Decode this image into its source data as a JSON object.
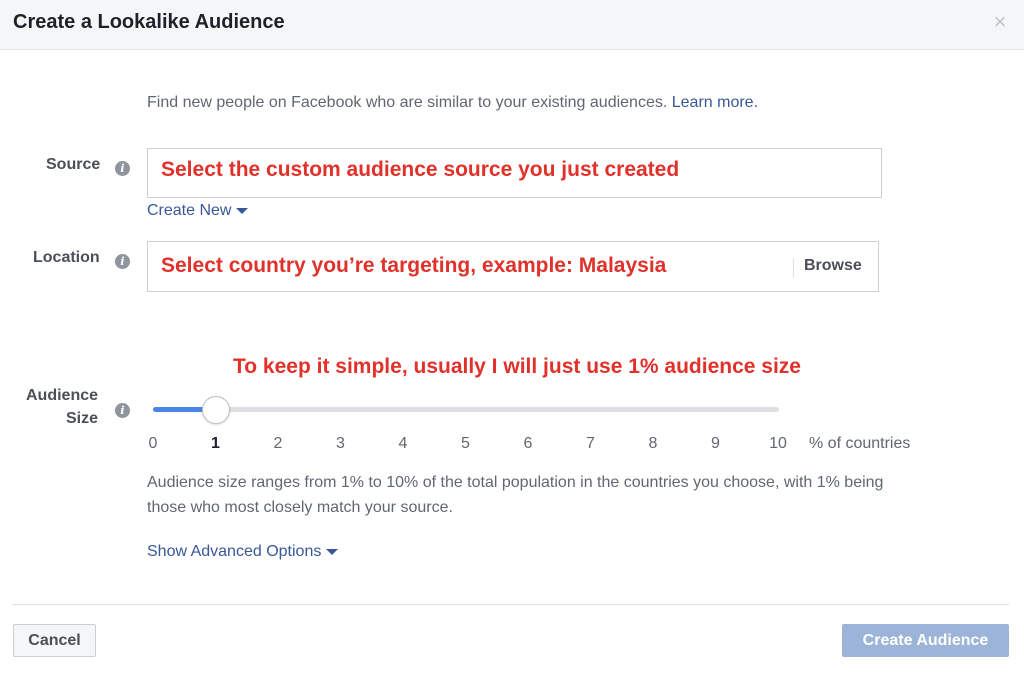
{
  "dialog": {
    "title": "Create a Lookalike Audience",
    "close_icon": "close-icon"
  },
  "intro": {
    "text": "Find new people on Facebook who are similar to your existing audiences.",
    "link": "Learn more."
  },
  "source": {
    "label": "Source",
    "value": "Select the custom audience source you just created",
    "create_new": "Create New"
  },
  "location": {
    "label": "Location",
    "value": "Select country you’re targeting, example: Malaysia",
    "browse": "Browse"
  },
  "audience_size": {
    "label_line1": "Audience",
    "label_line2": "Size",
    "annotation": "To keep it simple, usually I will just use 1% audience size",
    "selected": 1,
    "min": 0,
    "max": 10,
    "ticks": [
      "0",
      "1",
      "2",
      "3",
      "4",
      "5",
      "6",
      "7",
      "8",
      "9",
      "10"
    ],
    "unit": "% of countries",
    "help": "Audience size ranges from 1% to 10% of the total population in the countries you choose, with 1% being those who most closely match your source."
  },
  "advanced": {
    "label": "Show Advanced Options"
  },
  "footer": {
    "cancel": "Cancel",
    "create": "Create Audience"
  },
  "colors": {
    "accent": "#4a86e8",
    "link": "#385898",
    "annotation": "#e0312a",
    "primary_disabled": "#9cb4d8"
  }
}
